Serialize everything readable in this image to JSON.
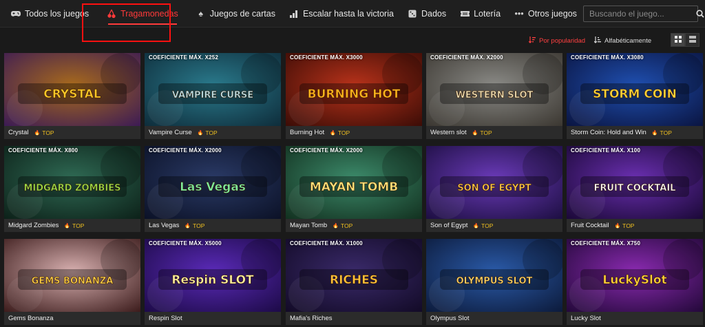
{
  "nav": {
    "items": [
      {
        "label": "Todos los juegos",
        "icon": "gamepad-icon"
      },
      {
        "label": "Tragamonedas",
        "icon": "cherry-icon",
        "active": true
      },
      {
        "label": "Juegos de cartas",
        "icon": "spade-icon"
      },
      {
        "label": "Escalar hasta la victoria",
        "icon": "bars-icon"
      },
      {
        "label": "Dados",
        "icon": "dice-icon"
      },
      {
        "label": "Lotería",
        "icon": "ticket-icon"
      },
      {
        "label": "Otros juegos",
        "icon": "dots-icon"
      }
    ],
    "more_icon": "list-chevron-icon"
  },
  "search": {
    "placeholder": "Buscando el juego..."
  },
  "sort": {
    "popularity": "Por popularidad",
    "alphabetical": "Alfabéticamente"
  },
  "colors": {
    "accent": "#ff3a3a",
    "badge": "#f0c020",
    "card_bg": "#2b2b2b",
    "page_bg": "#1a1a1a"
  },
  "games": [
    {
      "name": "Crystal",
      "badge": "TOP",
      "coef": "",
      "logo": "CRYSTAL",
      "bg1": "#a86a1c",
      "bg2": "#3b1a55",
      "logo_color": "#ffc928"
    },
    {
      "name": "Vampire Curse",
      "badge": "TOP",
      "coef": "COEFICIENTE MÁX. X252",
      "logo": "VAMPIRE CURSE",
      "bg1": "#2a7a8c",
      "bg2": "#0e2c3a",
      "logo_color": "#bfe7f0"
    },
    {
      "name": "Burning Hot",
      "badge": "TOP",
      "coef": "COEFICIENTE MÁX. X3000",
      "logo": "BURNING HOT",
      "bg1": "#b8321a",
      "bg2": "#3a0c06",
      "logo_color": "#ffb21c"
    },
    {
      "name": "Western slot",
      "badge": "TOP",
      "coef": "COEFICIENTE MÁX. X2000",
      "logo": "WESTERN SLOT",
      "bg1": "#8a8a86",
      "bg2": "#3a3630",
      "logo_color": "#f2e3b8"
    },
    {
      "name": "Storm Coin: Hold and Win",
      "badge": "TOP",
      "coef": "COEFICIENTE MÁX. X3080",
      "logo": "STORM COIN",
      "bg1": "#1f4fb0",
      "bg2": "#0a1440",
      "logo_color": "#ffd43a"
    },
    {
      "name": "Midgard Zombies",
      "badge": "TOP",
      "coef": "COEFICIENTE MÁX. X800",
      "logo": "MIDGARD ZOMBIES",
      "bg1": "#2f6a54",
      "bg2": "#0c2018",
      "logo_color": "#9de04a"
    },
    {
      "name": "Las Vegas",
      "badge": "TOP",
      "coef": "COEFICIENTE MÁX. X2000",
      "logo": "Las Vegas",
      "bg1": "#2a3a66",
      "bg2": "#0b1126",
      "logo_color": "#7ef0a0"
    },
    {
      "name": "Mayan Tomb",
      "badge": "TOP",
      "coef": "COEFICIENTE MÁX. X2000",
      "logo": "MAYAN TOMB",
      "bg1": "#3c8a6a",
      "bg2": "#12301f",
      "logo_color": "#ffe27a"
    },
    {
      "name": "Son of Egypt",
      "badge": "TOP",
      "coef": "",
      "logo": "SON OF EGYPT",
      "bg1": "#6a3ab8",
      "bg2": "#1c0e40",
      "logo_color": "#ffc84a"
    },
    {
      "name": "Fruit Cocktail",
      "badge": "TOP",
      "coef": "COEFICIENTE MÁX. X100",
      "logo": "FRUIT COCKTAIL",
      "bg1": "#6a2fb0",
      "bg2": "#1a0836",
      "logo_color": "#ffffff"
    },
    {
      "name": "Gems Bonanza",
      "badge": "",
      "coef": "",
      "logo": "GEMS BONANZA",
      "bg1": "#d8b0b0",
      "bg2": "#3a1a1a",
      "logo_color": "#ffd24a"
    },
    {
      "name": "Respin Slot",
      "badge": "",
      "coef": "COEFICIENTE MÁX. X5000",
      "logo": "Respin SLOT",
      "bg1": "#5a2ab8",
      "bg2": "#1c0a46",
      "logo_color": "#fff2a0"
    },
    {
      "name": "Mafia's Riches",
      "badge": "",
      "coef": "COEFICIENTE MÁX. X1000",
      "logo": "RICHES",
      "bg1": "#3a2a6a",
      "bg2": "#120a26",
      "logo_color": "#ffc23a"
    },
    {
      "name": "Olympus Slot",
      "badge": "",
      "coef": "",
      "logo": "OLYMPUS SLOT",
      "bg1": "#2a5aa8",
      "bg2": "#0c1a3a",
      "logo_color": "#ffd86a"
    },
    {
      "name": "Lucky Slot",
      "badge": "",
      "coef": "COEFICIENTE MÁX. X750",
      "logo": "LuckySlot",
      "bg1": "#8a2ab0",
      "bg2": "#220838",
      "logo_color": "#ffd23a"
    }
  ]
}
